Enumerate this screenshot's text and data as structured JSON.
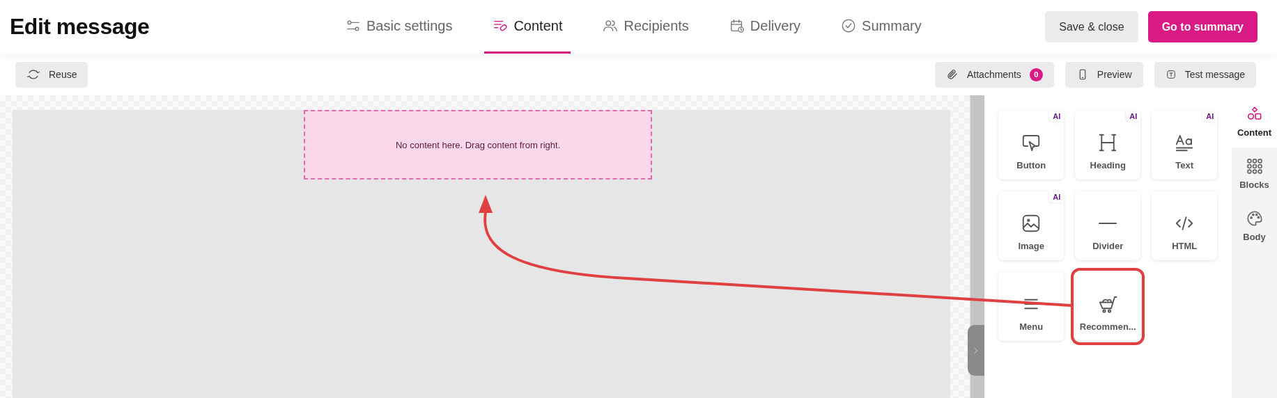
{
  "title": "Edit message",
  "steps": [
    {
      "label": "Basic settings",
      "kind": "settings",
      "selected": false
    },
    {
      "label": "Content",
      "kind": "content",
      "selected": true
    },
    {
      "label": "Recipients",
      "kind": "recipients",
      "selected": false
    },
    {
      "label": "Delivery",
      "kind": "delivery",
      "selected": false
    },
    {
      "label": "Summary",
      "kind": "summary",
      "selected": false
    }
  ],
  "header_buttons": [
    {
      "label": "Save & close",
      "primary": false
    },
    {
      "label": "Go to summary",
      "primary": true
    }
  ],
  "toolbar": {
    "reuse": "Reuse",
    "attachments": {
      "label": "Attachments",
      "count": "0"
    },
    "preview": "Preview",
    "test": "Test message"
  },
  "drop_zone": {
    "message": "No content here. Drag content from right."
  },
  "blocks": [
    {
      "label": "Button",
      "kind": "button",
      "badge": "AI",
      "highlighted": false
    },
    {
      "label": "Heading",
      "kind": "heading",
      "badge": "AI",
      "highlighted": false
    },
    {
      "label": "Text",
      "kind": "text",
      "badge": "AI",
      "highlighted": false
    },
    {
      "label": "Image",
      "kind": "image",
      "badge": "AI",
      "highlighted": false
    },
    {
      "label": "Divider",
      "kind": "divider",
      "highlighted": false
    },
    {
      "label": "HTML",
      "kind": "html",
      "highlighted": false
    },
    {
      "label": "Menu",
      "kind": "menu",
      "highlighted": false
    },
    {
      "label": "Recommen...",
      "kind": "recommendation",
      "highlighted": true
    }
  ],
  "rail": [
    {
      "label": "Content",
      "kind": "content",
      "selected": true
    },
    {
      "label": "Blocks",
      "kind": "blocks",
      "selected": false
    },
    {
      "label": "Body",
      "kind": "body",
      "selected": false
    }
  ]
}
